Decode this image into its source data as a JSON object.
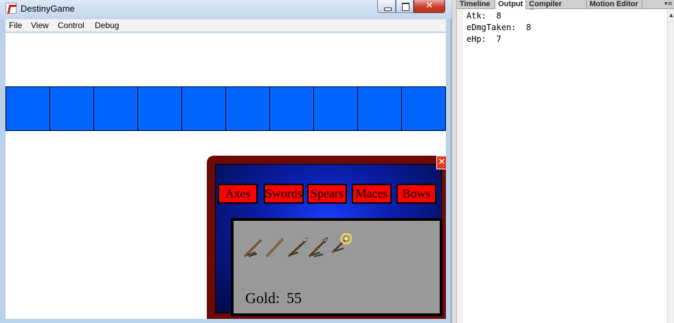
{
  "window": {
    "title": "DestinyGame",
    "close_glyph": "✕"
  },
  "menu": [
    "File",
    "View",
    "Control",
    "Debug"
  ],
  "inventory_slots": 10,
  "shop": {
    "close_glyph": "✕",
    "tabs": [
      "Axes",
      "Swords",
      "Spears",
      "Maces",
      "Bows"
    ],
    "items": [
      "spear-icon",
      "sword-icon",
      "spear-icon",
      "trident-icon",
      "golden-trident-icon"
    ],
    "gold_label": "Gold:",
    "gold_value": "55"
  },
  "panel": {
    "tabs": [
      "Timeline",
      "Output",
      "Compiler Errors",
      "Motion Editor"
    ],
    "active_tab": "Output",
    "menu_glyph": "▾≡",
    "output_lines": [
      "Atk:  8",
      "eDmgTaken:  8",
      "eHp:  7"
    ]
  },
  "colors": {
    "slot_blue": "#0066ff",
    "shop_tab_red": "#ff0000",
    "shop_frame": "#6e0a05"
  }
}
